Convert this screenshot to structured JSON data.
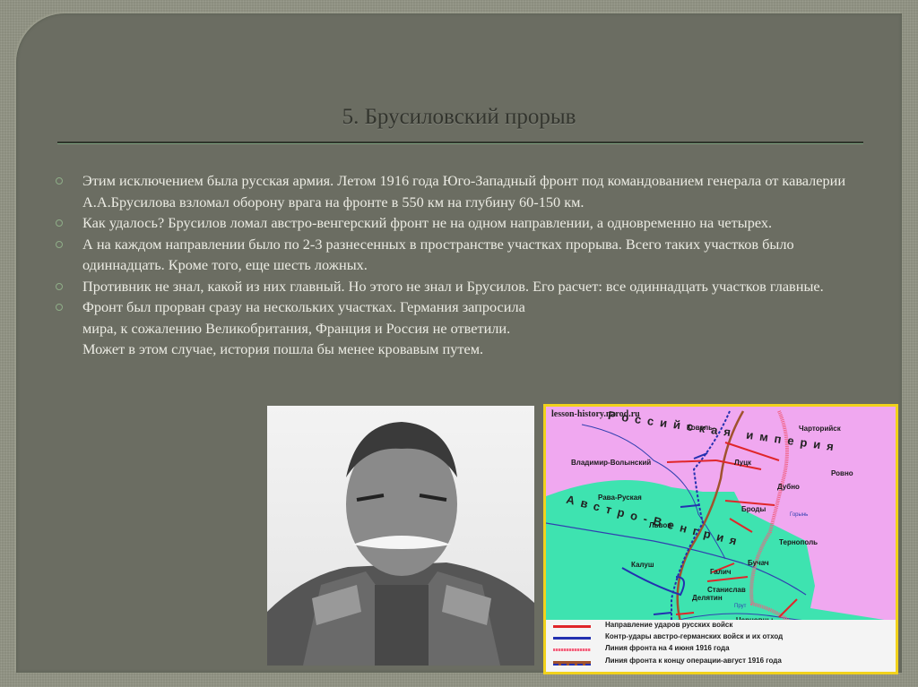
{
  "slide": {
    "title": "5. Брусиловский прорыв",
    "bullets": [
      "Этим исключением была русская армия. Летом 1916 года Юго-Западный фронт под командованием генерала от кавалерии А.А.Брусилова взломал оборону врага на фронте в 550 км на глубину 60-150 км.",
      "Как удалось? Брусилов ломал австро-венгерский фронт не на одном направлении, а одновременно на четырех.",
      "А на каждом направлении было по 2-3 разнесенных в пространстве участках прорыва. Всего таких участков было одиннадцать. Кроме того, еще шесть ложных.",
      "Противник не знал, какой из них главный. Но этого не знал и Брусилов. Его расчет: все одиннадцать участков главные.",
      "Фронт был прорван сразу на нескольких участках. Германия запросила мира, к сожалению Великобритания, Франция и Россия не ответили. Может в этом случае, история пошла бы менее кровавым путем."
    ]
  },
  "map": {
    "site": "lesson-history.narod.ru",
    "region_russia": "Российская империя",
    "region_austria": "Австро-Венгрия",
    "cities": [
      "Ковель",
      "Чарторийск",
      "Владимир-Волынский",
      "Луцк",
      "Ровно",
      "Дубно",
      "Рава-Руская",
      "Броды",
      "Львов",
      "Тернополь",
      "Калуш",
      "Бучач",
      "Галич",
      "Станислав",
      "Делятин",
      "Черновцы"
    ],
    "rivers": [
      "Горынь",
      "Прут"
    ],
    "legend": [
      "Направление ударов русских войск",
      "Контр-удары австро-германских войск и их отход",
      "Линия фронта на 4 июня 1916 года",
      "Линия фронта к концу операции-август 1916 года"
    ],
    "colors": {
      "russia": "#f0a8f0",
      "austria": "#3ee3b0",
      "border": "#f1d21c",
      "attack": "#e0262a",
      "counter": "#2330b0"
    }
  }
}
